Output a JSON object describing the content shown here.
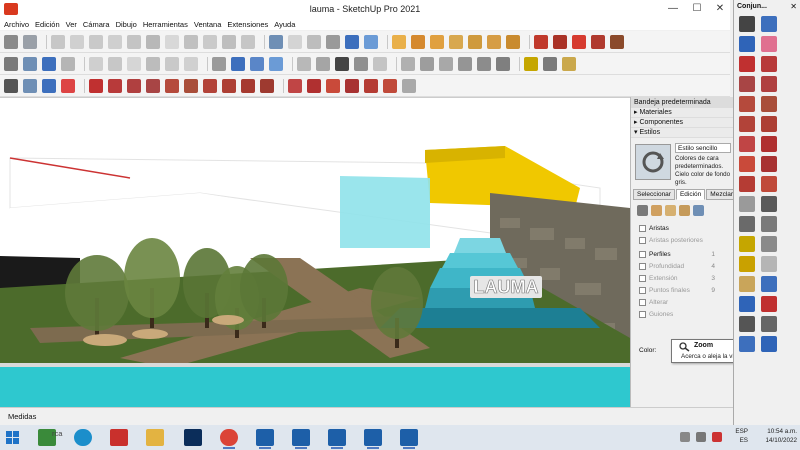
{
  "window": {
    "title": "lauma - SketchUp Pro 2021",
    "minimize": "—",
    "maximize": "☐",
    "close": "✕"
  },
  "menu": [
    "Archivo",
    "Edición",
    "Ver",
    "Cámara",
    "Dibujo",
    "Herramientas",
    "Ventana",
    "Extensiones",
    "Ayuda"
  ],
  "viewport": {
    "sign_text": "LAUMA"
  },
  "tray": {
    "title": "Bandeja predeterminada",
    "sections": [
      "▸ Materiales",
      "▸ Componentes",
      "▾ Estilos"
    ],
    "style_name": "Estilo sencillo",
    "style_description": "Colores de cara predeterminados. Cielo color de fondo gris.",
    "tabs": [
      "Seleccionar",
      "Edición",
      "Mezclar"
    ],
    "active_tab": "Edición",
    "settings": [
      {
        "label": "Aristas",
        "value": ""
      },
      {
        "label": "Aristas posteriores",
        "value": ""
      },
      {
        "label": "Perfiles",
        "value": "1"
      },
      {
        "label": "Profundidad",
        "value": "4"
      },
      {
        "label": "Extensión",
        "value": "3"
      },
      {
        "label": "Puntos finales",
        "value": "9"
      },
      {
        "label": "Alterar",
        "value": ""
      },
      {
        "label": "Guiones",
        "value": ""
      }
    ],
    "color_label": "Color:"
  },
  "tooltip": {
    "title": "Zoom",
    "description": "Acerca o aleja la vista de la cámara."
  },
  "right_panel": {
    "title": "Conjun...",
    "close": "✕"
  },
  "statusbar": {
    "measure_label": "Medidas"
  },
  "taskbar": {
    "search_text": "rca",
    "language": "ESP",
    "region": "ES",
    "time": "10:54 a.m.",
    "date": "14/10/2022"
  },
  "colors": {
    "accent_blue": "#3d6fbd",
    "sky": "#ffffff",
    "grass": "#4c6b2b",
    "water": "#2ec8cf",
    "yellow_roof": "#f0c800"
  }
}
